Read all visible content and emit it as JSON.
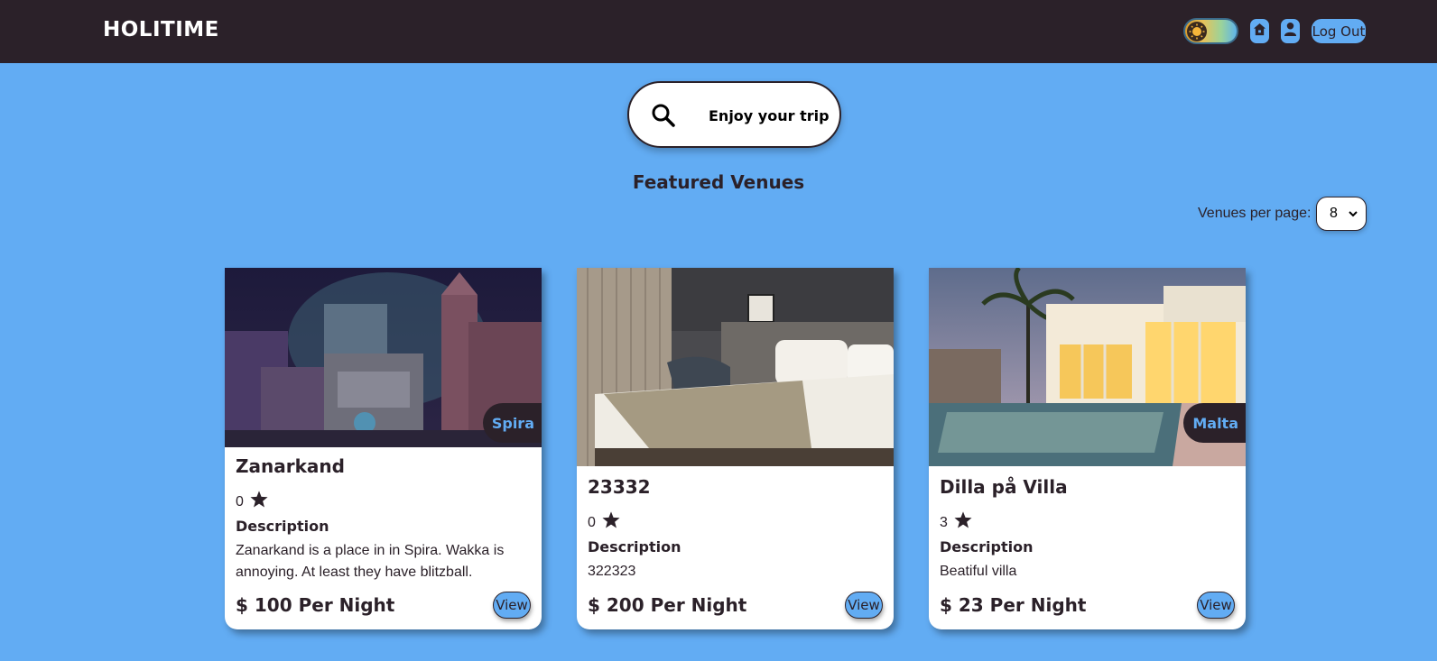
{
  "header": {
    "brand": "HOLITIME",
    "theme_toggle_icon": "sun-icon",
    "home_icon": "home-icon",
    "user_icon": "user-icon",
    "logout_label": "Log Out"
  },
  "search": {
    "icon": "search-icon",
    "label": "Enjoy your trip"
  },
  "section": {
    "title": "Featured Venues",
    "per_page_label": "Venues per page:",
    "per_page_value": "8"
  },
  "venues": [
    {
      "name": "Zanarkand",
      "location": "Spira",
      "rating": "0",
      "description_label": "Description",
      "description": "Zanarkand is a place in in Spira. Wakka is annoying. At least they have blitzball.",
      "price": "$ 100 Per Night",
      "view_label": "View"
    },
    {
      "name": "23332",
      "location": "",
      "rating": "0",
      "description_label": "Description",
      "description": "322323",
      "price": "$ 200 Per Night",
      "view_label": "View"
    },
    {
      "name": "Dilla på Villa",
      "location": "Malta",
      "rating": "3",
      "description_label": "Description",
      "description": "Beatiful villa",
      "price": "$ 23 Per Night",
      "view_label": "View"
    }
  ],
  "colors": {
    "background": "#62acf3",
    "dark": "#2b2129",
    "card": "#ffffff"
  }
}
